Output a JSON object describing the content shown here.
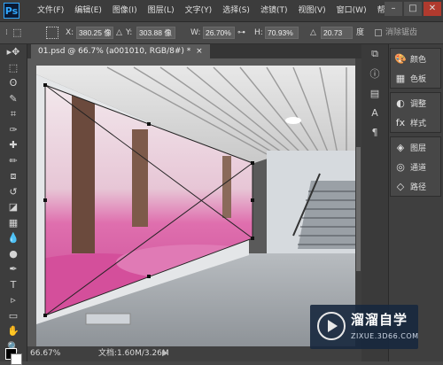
{
  "app": {
    "logo": "Ps"
  },
  "menu": [
    "文件(F)",
    "编辑(E)",
    "图像(I)",
    "图层(L)",
    "文字(Y)",
    "选择(S)",
    "滤镜(T)",
    "视图(V)",
    "窗口(W)",
    "帮助"
  ],
  "window_controls": {
    "minimize": "–",
    "maximize": "□",
    "close": "✕"
  },
  "options": {
    "x_label": "X:",
    "x_value": "380.25 像",
    "y_label": "Y:",
    "y_value": "303.88 像",
    "w_label": "W:",
    "w_value": "26.70%",
    "h_label": "H:",
    "h_value": "70.93%",
    "angle_value": "20.73",
    "angle_unit": "度",
    "antialias_label": "消除锯齿"
  },
  "document": {
    "tab_title": "01.psd @ 66.7% (a001010, RGB/8#) *",
    "tab_close": "×",
    "zoom": "66.67%",
    "doc_info": "文档:1.60M/3.26M"
  },
  "tools": [
    "move-tool",
    "marquee-tool",
    "lasso-tool",
    "quick-select-tool",
    "crop-tool",
    "eyedropper-tool",
    "healing-tool",
    "brush-tool",
    "clone-stamp-tool",
    "history-brush-tool",
    "eraser-tool",
    "gradient-tool",
    "blur-tool",
    "dodge-tool",
    "pen-tool",
    "type-tool",
    "path-select-tool",
    "shape-tool",
    "hand-tool",
    "zoom-tool"
  ],
  "tool_glyphs": [
    "▸✥",
    "⬚",
    "ʘ",
    "✎",
    "⌗",
    "✑",
    "✚",
    "✏",
    "⧈",
    "↺",
    "◪",
    "▦",
    "💧",
    "●",
    "✒",
    "T",
    "▹",
    "▭",
    "✋",
    "🔍"
  ],
  "panels": [
    {
      "label": "颜色",
      "icon": "palette-icon",
      "glyph": "🎨"
    },
    {
      "label": "色板",
      "icon": "swatches-icon",
      "glyph": "▦"
    },
    {
      "label": "调整",
      "icon": "adjustments-icon",
      "glyph": "◐"
    },
    {
      "label": "样式",
      "icon": "styles-icon",
      "glyph": "fx"
    },
    {
      "label": "图层",
      "icon": "layers-icon",
      "glyph": "◈"
    },
    {
      "label": "通道",
      "icon": "channels-icon",
      "glyph": "◎"
    },
    {
      "label": "路径",
      "icon": "paths-icon",
      "glyph": "◇"
    }
  ],
  "watermark": {
    "title": "溜溜自学",
    "subtitle": "ZIXUE.3D66.COM"
  },
  "colors": {
    "menubar": "#3c3c3c",
    "canvas_bg": "#5a5a5a",
    "accent": "#30a8ff",
    "watermark_bg": "#17283e"
  }
}
